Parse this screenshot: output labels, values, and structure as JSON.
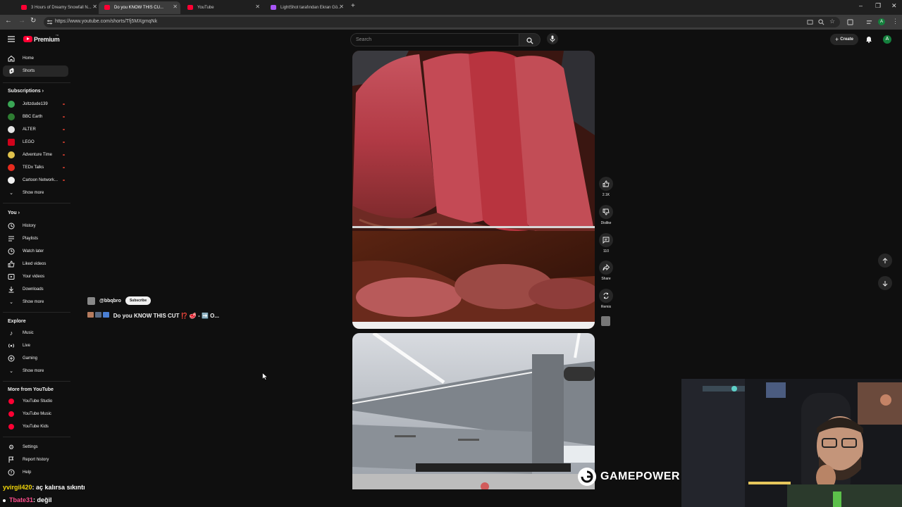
{
  "browser": {
    "tabs": [
      {
        "title": "3 Hours of Dreamy Snowfall N..."
      },
      {
        "title": "Do you KNOW THIS CU..."
      },
      {
        "title": "YouTube"
      },
      {
        "title": "LightShot tarafından Ekran Gö..."
      }
    ],
    "url": "https://www.youtube.com/shorts/Tfj5MXgmqNk",
    "profile_initial": "A"
  },
  "header": {
    "logo_text": "Premium",
    "logo_superscript": "TR",
    "search_placeholder": "Search",
    "create_label": "Create",
    "avatar_initial": "A"
  },
  "sidebar": {
    "main": [
      {
        "label": "Home"
      },
      {
        "label": "Shorts"
      }
    ],
    "subscriptions_title": "Subscriptions",
    "subscriptions": [
      {
        "label": "Joltzdude139",
        "color": "#3aa655"
      },
      {
        "label": "BBC Earth",
        "color": "#2e7d32"
      },
      {
        "label": "ALTER",
        "color": "#e5e5e5"
      },
      {
        "label": "LEGO",
        "color": "#d0021b"
      },
      {
        "label": "Adventure Time",
        "color": "#e0c24c"
      },
      {
        "label": "TEDx Talks",
        "color": "#e62b1e"
      },
      {
        "label": "Cartoon Network...",
        "color": "#f1f1f1"
      }
    ],
    "subs_show_more": "Show more",
    "you_title": "You",
    "you": [
      {
        "label": "History"
      },
      {
        "label": "Playlists"
      },
      {
        "label": "Watch later"
      },
      {
        "label": "Liked videos"
      },
      {
        "label": "Your videos"
      },
      {
        "label": "Downloads"
      },
      {
        "label": "Show more"
      }
    ],
    "explore_title": "Explore",
    "explore": [
      {
        "label": "Music"
      },
      {
        "label": "Live"
      },
      {
        "label": "Gaming"
      },
      {
        "label": "Show more"
      }
    ],
    "more_title": "More from YouTube",
    "more": [
      {
        "label": "YouTube Studio"
      },
      {
        "label": "YouTube Music"
      },
      {
        "label": "YouTube Kids"
      }
    ],
    "footer": [
      {
        "label": "Settings"
      },
      {
        "label": "Report history"
      },
      {
        "label": "Help"
      }
    ]
  },
  "short": {
    "channel": "@bbqbro",
    "subscribe_label": "Subscribe",
    "title": "Do you KNOW THIS CUT ⁉️ 🥩 - ➡️ O...",
    "actions": {
      "like_count": "2.1K",
      "dislike_label": "Dislike",
      "comment_count": "110",
      "share_label": "Share",
      "remix_label": "Remix"
    }
  },
  "overlay": {
    "watermark": "GAMEPOWER",
    "chat": [
      {
        "user": "yvirgil420",
        "message": "aç kalırsa sıkıntı",
        "color": "#f5d90a"
      },
      {
        "user": "Tbate31",
        "message": "değil",
        "color": "#ff4d8d"
      }
    ]
  },
  "colors": {
    "background": "#0f0f0f",
    "youtube_red": "#ff0033",
    "surface": "#272727"
  }
}
